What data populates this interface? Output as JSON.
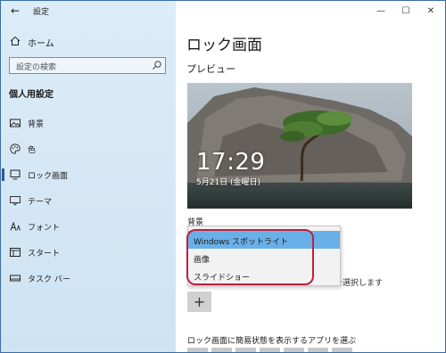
{
  "app": {
    "title": "設定",
    "back_icon": "back-arrow-icon"
  },
  "window_controls": {
    "minimize": "—",
    "maximize": "☐",
    "close": "✕"
  },
  "sidebar": {
    "home_label": "ホーム",
    "search_placeholder": "設定の検索",
    "section_title": "個人用設定",
    "items": [
      {
        "label": "背景",
        "icon": "image-icon",
        "active": false
      },
      {
        "label": "色",
        "icon": "palette-icon",
        "active": false
      },
      {
        "label": "ロック画面",
        "icon": "lock-screen-icon",
        "active": true
      },
      {
        "label": "テーマ",
        "icon": "theme-brush-icon",
        "active": false
      },
      {
        "label": "フォント",
        "icon": "font-icon",
        "active": false
      },
      {
        "label": "スタート",
        "icon": "start-menu-icon",
        "active": false
      },
      {
        "label": "タスク バー",
        "icon": "taskbar-icon",
        "active": false
      }
    ]
  },
  "main": {
    "title": "ロック画面",
    "preview_label": "プレビュー",
    "preview": {
      "time": "17:29",
      "date": "5月21日 (金曜日)"
    },
    "background_label": "背景",
    "dropdown_options": [
      {
        "label": "Windows スポットライト",
        "selected": true
      },
      {
        "label": "画像",
        "selected": false
      },
      {
        "label": "スライドショー",
        "selected": false
      }
    ],
    "behind_text": "を選択します",
    "add_button": "+",
    "quick_status_label": "ロック画面に簡易状態を表示するアプリを選ぶ"
  },
  "colors": {
    "selected": "#6ab0e8",
    "annotation_ring": "#c0203c",
    "sidebar_bg": "#d6e8f6",
    "active_indicator": "#2b5797"
  }
}
